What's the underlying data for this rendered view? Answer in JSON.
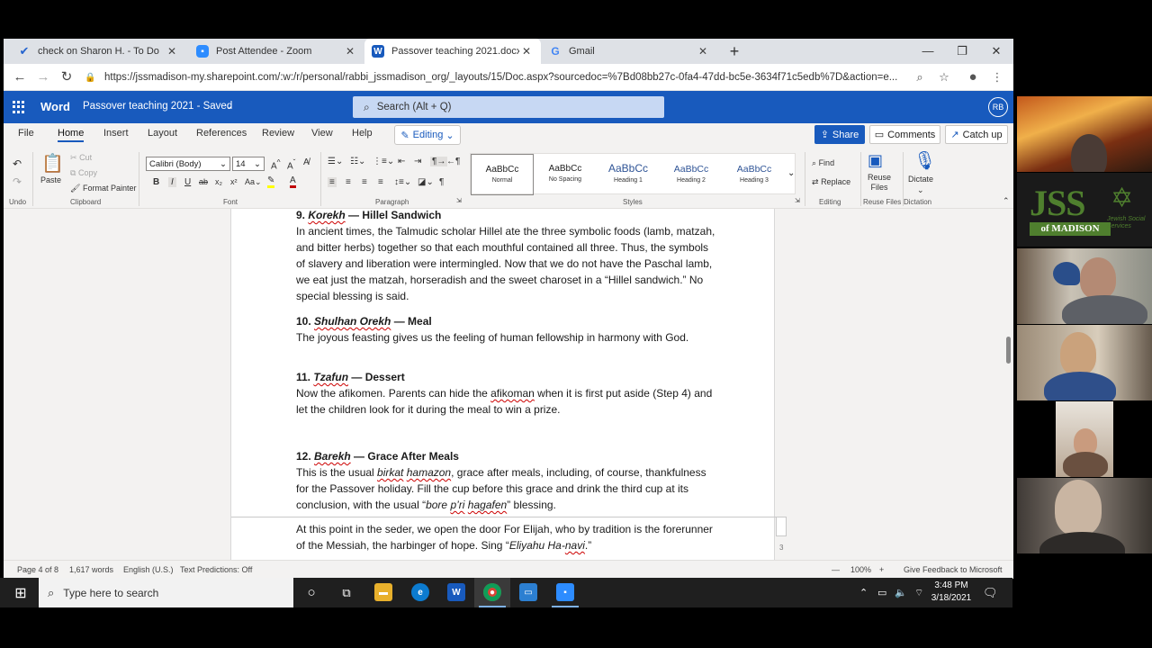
{
  "browser": {
    "tabs": [
      {
        "label": "check on Sharon H. - To Do",
        "icon": "todo-check-icon",
        "color": "#2564cf"
      },
      {
        "label": "Post Attendee - Zoom",
        "icon": "zoom-icon",
        "color": "#2d8cff"
      },
      {
        "label": "Passover teaching 2021.docx",
        "icon": "word-icon",
        "color": "#185abd"
      },
      {
        "label": "Gmail",
        "icon": "google-icon",
        "color": "#4285f4"
      }
    ],
    "url": "https://jssmadison-my.sharepoint.com/:w:/r/personal/rabbi_jssmadison_org/_layouts/15/Doc.aspx?sourcedoc=%7Bd08bb27c-0fa4-47dd-bc5e-3634f71c5edb%7D&action=e..."
  },
  "word": {
    "app_name": "Word",
    "doc_title": "Passover teaching 2021  -  Saved",
    "search_placeholder": "Search (Alt + Q)",
    "user_initials": "RB",
    "menu_tabs": [
      "File",
      "Home",
      "Insert",
      "Layout",
      "References",
      "Review",
      "View",
      "Help"
    ],
    "editing_label": "Editing",
    "share_label": "Share",
    "comments_label": "Comments",
    "catchup_label": "Catch up",
    "accent": "#185abd"
  },
  "ribbon": {
    "undo_label": "Undo",
    "paste_label": "Paste",
    "cut_label": "Cut",
    "copy_label": "Copy",
    "format_painter_label": "Format Painter",
    "clipboard_label": "Clipboard",
    "font_name": "Calibri (Body)",
    "font_size": "14",
    "font_label": "Font",
    "paragraph_label": "Paragraph",
    "styles": [
      {
        "sample": "AaBbCc",
        "name": "Normal"
      },
      {
        "sample": "AaBbCc",
        "name": "No Spacing"
      },
      {
        "sample": "AaBbCc",
        "name": "Heading 1"
      },
      {
        "sample": "AaBbCc",
        "name": "Heading 2"
      },
      {
        "sample": "AaBbCc",
        "name": "Heading 3"
      }
    ],
    "styles_label": "Styles",
    "find_label": "Find",
    "replace_label": "Replace",
    "editing_group_label": "Editing",
    "reuse_label": "Reuse Files",
    "reuse_button_line1": "Reuse",
    "reuse_button_line2": "Files",
    "dictate_label": "Dictate",
    "dictation_label": "Dictation"
  },
  "document": {
    "s9_num": "9. ",
    "s9_term": "Korekh",
    "s9_rest": " — Hillel Sandwich",
    "s9_body": "In ancient times, the Talmudic scholar Hillel ate the three symbolic foods (lamb, matzah, and bitter herbs) together so that each mouthful contained all three. Thus, the symbols of slavery and liberation were intermingled. Now that we do not have the Paschal lamb, we eat just the matzah, horseradish and the sweet charoset in a “Hillel sandwich.” No special blessing is said.",
    "s10_num": "10. ",
    "s10_term": "Shulhan Orekh",
    "s10_rest": " — Meal",
    "s10_body": "The joyous feasting gives us the feeling of human fellowship in harmony with God.",
    "s11_num": "11. ",
    "s11_term": "Tzafun",
    "s11_rest": " — Dessert",
    "s11_body_a": "Now the afikomen. Parents can hide the ",
    "s11_body_sq": "afikoman",
    "s11_body_b": " when it is first put aside (Step 4) and let the children look for it during the meal to win a prize.",
    "s12_num": "12. ",
    "s12_term": "Barekh",
    "s12_rest": " — Grace After Meals",
    "s12_body_a": "This is the usual ",
    "s12_body_i1": "birkat",
    "s12_body_sp": " ",
    "s12_body_i2": "hamazon",
    "s12_body_b": ", grace after meals, including, of course, thankfulness for the Passover holiday. Fill the cup before this grace and drink the third cup at its conclusion, with the usual “",
    "s12_body_i3a": "bore ",
    "s12_body_i3b": "p’ri",
    "s12_body_sp2": " ",
    "s12_body_i3c": "hagafen",
    "s12_body_c": "” blessing.",
    "s13_body_a": "At this point in the seder, we open the door For Elijah, who by tradition is the forerunner of the Messiah, the harbinger of hope. Sing “",
    "s13_body_i": "Eliyahu Ha-",
    "s13_body_i2": "navi",
    "s13_body_b": ".”",
    "margin_page_num": "3"
  },
  "status": {
    "page": "Page 4 of 8",
    "words": "1,617 words",
    "language": "English (U.S.)",
    "predictions": "Text Predictions: Off",
    "zoom": "100%",
    "feedback": "Give Feedback to Microsoft"
  },
  "taskbar": {
    "search_placeholder": "Type here to search",
    "time": "3:48 PM",
    "date": "3/18/2021"
  },
  "video": {
    "jss_logo_text": "JSS",
    "jss_logo_sub": "of MADISON",
    "jss_logo_side": "Jewish Social Services"
  }
}
